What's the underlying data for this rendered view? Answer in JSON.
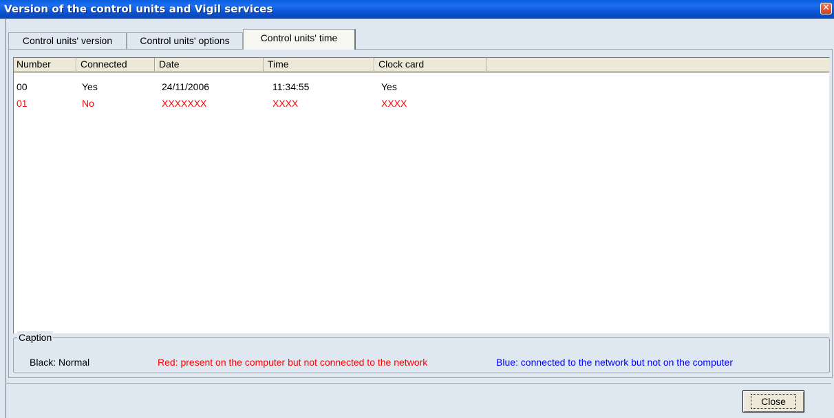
{
  "window": {
    "title": "Version of the control units and Vigil services",
    "close_glyph": "✕"
  },
  "tabs": [
    {
      "label": "Control units' version",
      "active": false
    },
    {
      "label": "Control units' options",
      "active": false
    },
    {
      "label": "Control units' time",
      "active": true
    }
  ],
  "table": {
    "columns": [
      "Number",
      "Connected",
      "Date",
      "Time",
      "Clock card"
    ],
    "rows": [
      {
        "number": "00",
        "connected": "Yes",
        "date": "24/11/2006",
        "time": "11:34:55",
        "clock_card": "Yes",
        "status": "normal"
      },
      {
        "number": "01",
        "connected": "No",
        "date": "XXXXXXX",
        "time": "XXXX",
        "clock_card": "XXXX",
        "status": "not_connected"
      }
    ]
  },
  "caption": {
    "title": "Caption",
    "black": "Black: Normal",
    "red": "Red: present on the computer but not connected to the network",
    "blue": "Blue: connected to the network but not on the computer"
  },
  "buttons": {
    "close": "Close"
  },
  "colors": {
    "titlebar": "#0a52d0",
    "red_status": "#ff0000",
    "blue_status": "#0000ff",
    "background": "#dfe8f1"
  }
}
